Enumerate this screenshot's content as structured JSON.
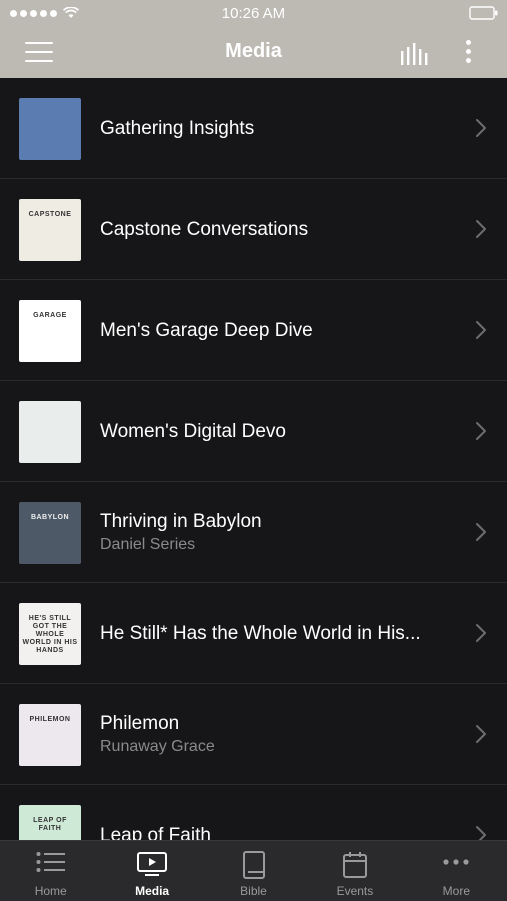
{
  "status_bar": {
    "time": "10:26 AM"
  },
  "nav": {
    "title": "Media"
  },
  "items": [
    {
      "title": "Gathering Insights",
      "subtitle": "",
      "thumb_color": "#5a7cb0",
      "thumb_text": ""
    },
    {
      "title": "Capstone Conversations",
      "subtitle": "",
      "thumb_color": "#efece4",
      "thumb_text": "CAPSTONE"
    },
    {
      "title": "Men's Garage Deep Dive",
      "subtitle": "",
      "thumb_color": "#ffffff",
      "thumb_text": "GARAGE"
    },
    {
      "title": "Women's Digital Devo",
      "subtitle": "",
      "thumb_color": "#e9eeec",
      "thumb_text": ""
    },
    {
      "title": "Thriving in Babylon",
      "subtitle": "Daniel Series",
      "thumb_color": "#4d5966",
      "thumb_text": "BABYLON"
    },
    {
      "title": "He Still* Has the Whole World in His...",
      "subtitle": "",
      "thumb_color": "#f2f1ef",
      "thumb_text": "HE'S STILL GOT THE WHOLE WORLD IN HIS HANDS"
    },
    {
      "title": "Philemon",
      "subtitle": "Runaway Grace",
      "thumb_color": "#ece8ee",
      "thumb_text": "PHILEMON"
    },
    {
      "title": "Leap of Faith",
      "subtitle": "",
      "thumb_color": "#cfe9d7",
      "thumb_text": "LEAP OF FAITH"
    }
  ],
  "tabs": [
    {
      "label": "Home",
      "icon": "list-icon",
      "active": false
    },
    {
      "label": "Media",
      "icon": "tv-icon",
      "active": true
    },
    {
      "label": "Bible",
      "icon": "book-icon",
      "active": false
    },
    {
      "label": "Events",
      "icon": "calendar-icon",
      "active": false
    },
    {
      "label": "More",
      "icon": "more-icon",
      "active": false
    }
  ]
}
